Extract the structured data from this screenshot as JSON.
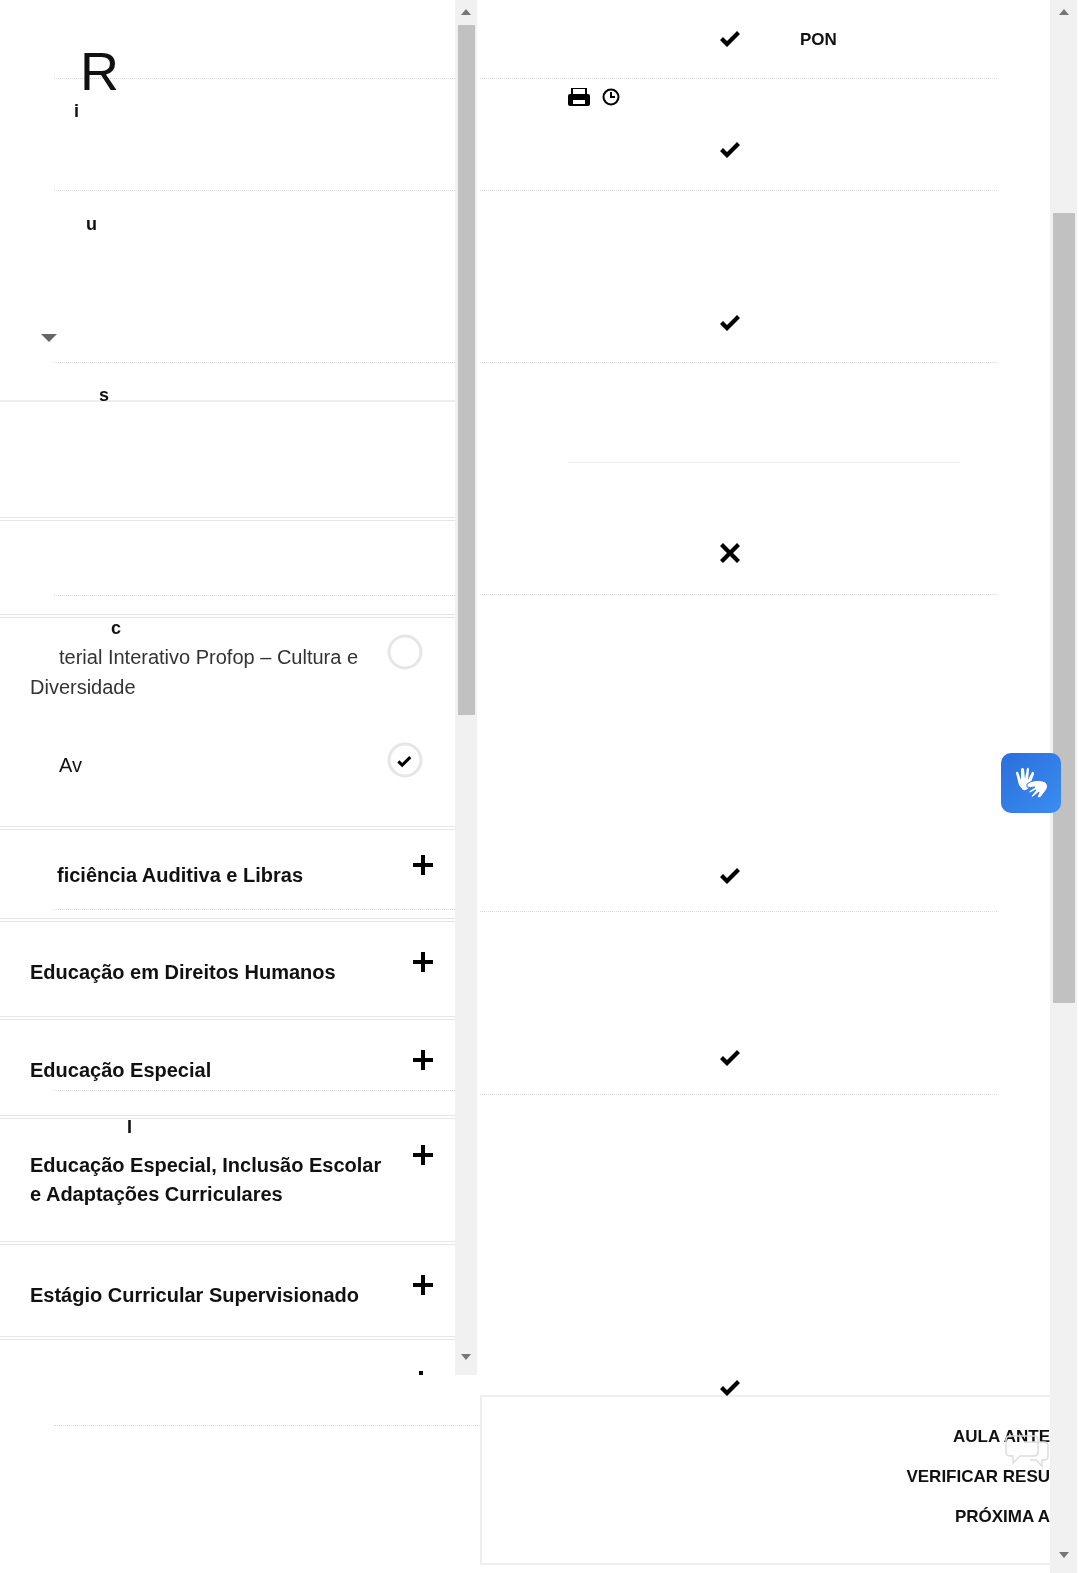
{
  "course_menu": {
    "fragments": [
      "R",
      "i",
      "u",
      "s"
    ],
    "lesson_group": {
      "fragment": "c",
      "lessons": [
        {
          "title": "terial Interativo Profop – Cultura e Diversidade",
          "completed": false
        },
        {
          "title": "Av",
          "completed": true
        }
      ]
    },
    "modules": [
      {
        "title": "ficiência Auditiva e Libras",
        "expanded": false
      },
      {
        "title": "Educação em Direitos Humanos",
        "expanded": false
      },
      {
        "title": "Educação Especial",
        "expanded": false
      },
      {
        "fragment": "I",
        "title": "Educação Especial, Inclusão Escolar e Adaptações Curriculares",
        "expanded": false
      },
      {
        "title": "Estágio Curricular Supervisionado",
        "expanded": false
      }
    ]
  },
  "progress": {
    "header": "PON",
    "marks": [
      {
        "passed": true
      },
      {
        "passed": true
      },
      {
        "passed": true
      },
      {
        "passed": false
      },
      {
        "passed": true
      },
      {
        "passed": true
      },
      {
        "passed": true
      }
    ]
  },
  "lesson_nav": {
    "buttons": [
      "AULA ANTE",
      "VERIFICAR RESU",
      "PRÓXIMA A"
    ]
  }
}
